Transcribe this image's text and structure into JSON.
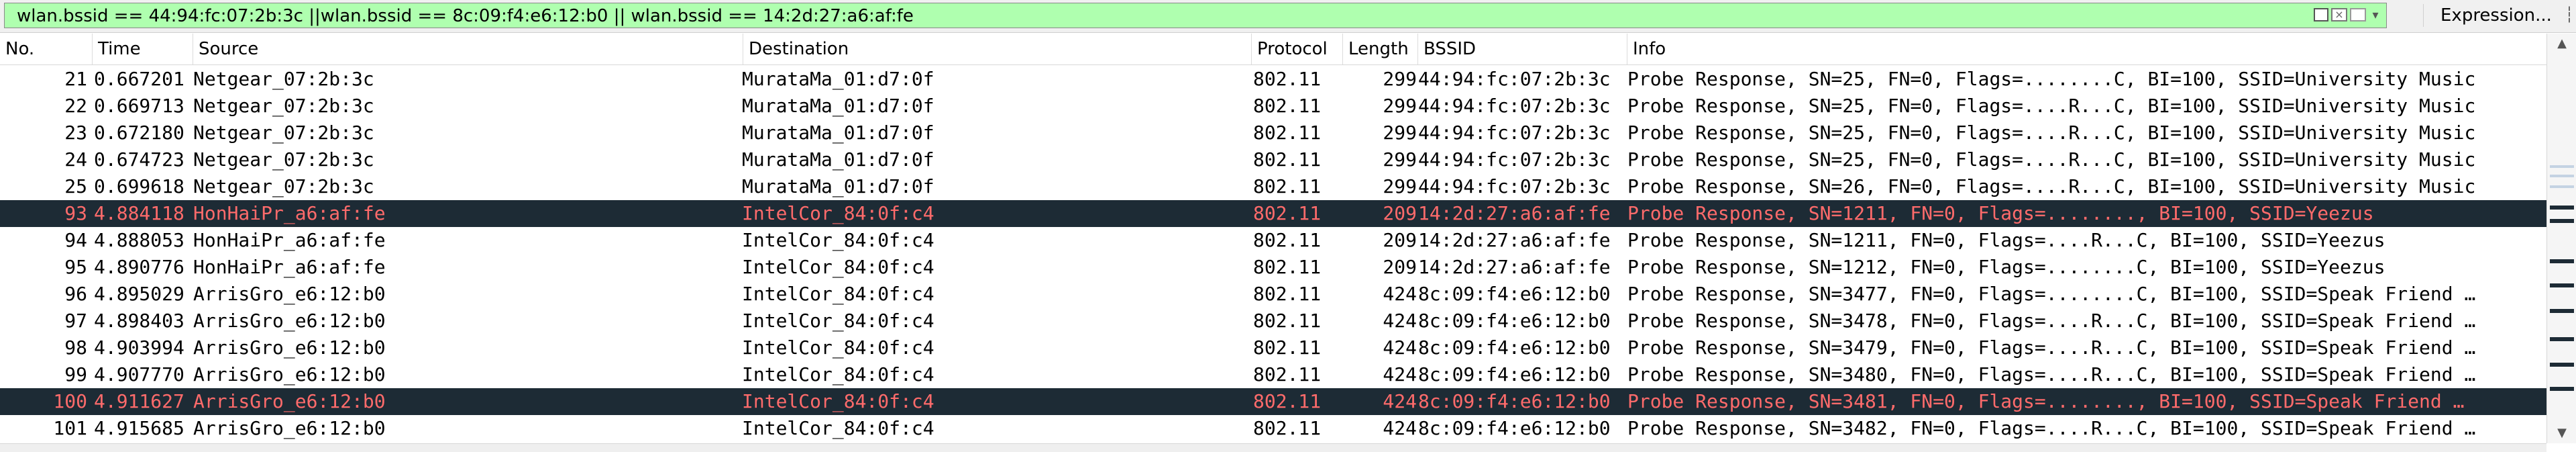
{
  "filter": {
    "value": "wlan.bssid == 44:94:fc:07:2b:3c ||wlan.bssid == 8c:09:f4:e6:12:b0 || wlan.bssid == 14:2d:27:a6:af:fe",
    "expression_label": "Expression..."
  },
  "columns": {
    "no": "No.",
    "time": "Time",
    "source": "Source",
    "destination": "Destination",
    "protocol": "Protocol",
    "length": "Length",
    "bssid": "BSSID",
    "info": "Info"
  },
  "packets": [
    {
      "no": "21",
      "time": "0.667201",
      "source": "Netgear_07:2b:3c",
      "destination": "MurataMa_01:d7:0f",
      "protocol": "802.11",
      "length": "299",
      "bssid": "44:94:fc:07:2b:3c",
      "info": "Probe Response, SN=25, FN=0, Flags=........C, BI=100, SSID=University Music",
      "selected": false
    },
    {
      "no": "22",
      "time": "0.669713",
      "source": "Netgear_07:2b:3c",
      "destination": "MurataMa_01:d7:0f",
      "protocol": "802.11",
      "length": "299",
      "bssid": "44:94:fc:07:2b:3c",
      "info": "Probe Response, SN=25, FN=0, Flags=....R...C, BI=100, SSID=University Music",
      "selected": false
    },
    {
      "no": "23",
      "time": "0.672180",
      "source": "Netgear_07:2b:3c",
      "destination": "MurataMa_01:d7:0f",
      "protocol": "802.11",
      "length": "299",
      "bssid": "44:94:fc:07:2b:3c",
      "info": "Probe Response, SN=25, FN=0, Flags=....R...C, BI=100, SSID=University Music",
      "selected": false
    },
    {
      "no": "24",
      "time": "0.674723",
      "source": "Netgear_07:2b:3c",
      "destination": "MurataMa_01:d7:0f",
      "protocol": "802.11",
      "length": "299",
      "bssid": "44:94:fc:07:2b:3c",
      "info": "Probe Response, SN=25, FN=0, Flags=....R...C, BI=100, SSID=University Music",
      "selected": false
    },
    {
      "no": "25",
      "time": "0.699618",
      "source": "Netgear_07:2b:3c",
      "destination": "MurataMa_01:d7:0f",
      "protocol": "802.11",
      "length": "299",
      "bssid": "44:94:fc:07:2b:3c",
      "info": "Probe Response, SN=26, FN=0, Flags=....R...C, BI=100, SSID=University Music",
      "selected": false
    },
    {
      "no": "93",
      "time": "4.884118",
      "source": "HonHaiPr_a6:af:fe",
      "destination": "IntelCor_84:0f:c4",
      "protocol": "802.11",
      "length": "209",
      "bssid": "14:2d:27:a6:af:fe",
      "info": "Probe Response, SN=1211, FN=0, Flags=........, BI=100, SSID=Yeezus",
      "selected": true
    },
    {
      "no": "94",
      "time": "4.888053",
      "source": "HonHaiPr_a6:af:fe",
      "destination": "IntelCor_84:0f:c4",
      "protocol": "802.11",
      "length": "209",
      "bssid": "14:2d:27:a6:af:fe",
      "info": "Probe Response, SN=1211, FN=0, Flags=....R...C, BI=100, SSID=Yeezus",
      "selected": false
    },
    {
      "no": "95",
      "time": "4.890776",
      "source": "HonHaiPr_a6:af:fe",
      "destination": "IntelCor_84:0f:c4",
      "protocol": "802.11",
      "length": "209",
      "bssid": "14:2d:27:a6:af:fe",
      "info": "Probe Response, SN=1212, FN=0, Flags=........C, BI=100, SSID=Yeezus",
      "selected": false
    },
    {
      "no": "96",
      "time": "4.895029",
      "source": "ArrisGro_e6:12:b0",
      "destination": "IntelCor_84:0f:c4",
      "protocol": "802.11",
      "length": "424",
      "bssid": "8c:09:f4:e6:12:b0",
      "info": "Probe Response, SN=3477, FN=0, Flags=........C, BI=100, SSID=Speak Friend …",
      "selected": false
    },
    {
      "no": "97",
      "time": "4.898403",
      "source": "ArrisGro_e6:12:b0",
      "destination": "IntelCor_84:0f:c4",
      "protocol": "802.11",
      "length": "424",
      "bssid": "8c:09:f4:e6:12:b0",
      "info": "Probe Response, SN=3478, FN=0, Flags=....R...C, BI=100, SSID=Speak Friend …",
      "selected": false
    },
    {
      "no": "98",
      "time": "4.903994",
      "source": "ArrisGro_e6:12:b0",
      "destination": "IntelCor_84:0f:c4",
      "protocol": "802.11",
      "length": "424",
      "bssid": "8c:09:f4:e6:12:b0",
      "info": "Probe Response, SN=3479, FN=0, Flags=....R...C, BI=100, SSID=Speak Friend …",
      "selected": false
    },
    {
      "no": "99",
      "time": "4.907770",
      "source": "ArrisGro_e6:12:b0",
      "destination": "IntelCor_84:0f:c4",
      "protocol": "802.11",
      "length": "424",
      "bssid": "8c:09:f4:e6:12:b0",
      "info": "Probe Response, SN=3480, FN=0, Flags=....R...C, BI=100, SSID=Speak Friend …",
      "selected": false
    },
    {
      "no": "100",
      "time": "4.911627",
      "source": "ArrisGro_e6:12:b0",
      "destination": "IntelCor_84:0f:c4",
      "protocol": "802.11",
      "length": "424",
      "bssid": "8c:09:f4:e6:12:b0",
      "info": "Probe Response, SN=3481, FN=0, Flags=........, BI=100, SSID=Speak Friend …",
      "selected": true
    },
    {
      "no": "101",
      "time": "4.915685",
      "source": "ArrisGro_e6:12:b0",
      "destination": "IntelCor_84:0f:c4",
      "protocol": "802.11",
      "length": "424",
      "bssid": "8c:09:f4:e6:12:b0",
      "info": "Probe Response, SN=3482, FN=0, Flags=....R...C, BI=100, SSID=Speak Friend …",
      "selected": false
    }
  ],
  "icons": {
    "bookmark": "bookmark-icon",
    "clear": "clear-icon",
    "apply": "apply-icon",
    "history": "history-dropdown-icon"
  },
  "colors": {
    "filter_valid_bg": "#afffaf",
    "selected_row_bg": "#1d2b35",
    "selected_row_fg": "#ff6b6b"
  }
}
